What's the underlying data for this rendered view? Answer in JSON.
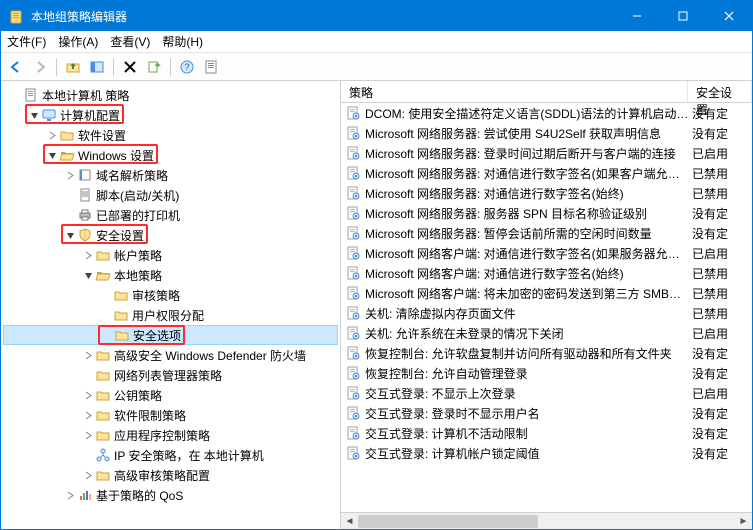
{
  "window": {
    "title": "本地组策略编辑器"
  },
  "menu": {
    "file": "文件(F)",
    "action": "操作(A)",
    "view": "查看(V)",
    "help": "帮助(H)"
  },
  "tree": {
    "root": "本地计算机 策略",
    "computer_cfg": "计算机配置",
    "software": "软件设置",
    "windows_settings": "Windows 设置",
    "dns": "域名解析策略",
    "scripts": "脚本(启动/关机)",
    "deployed_printers": "已部署的打印机",
    "security_settings": "安全设置",
    "account_policies": "帐户策略",
    "local_policies": "本地策略",
    "audit": "审核策略",
    "user_rights": "用户权限分配",
    "security_options": "安全选项",
    "defender": "高级安全 Windows Defender 防火墙",
    "nlm": "网络列表管理器策略",
    "pki": "公钥策略",
    "srp": "软件限制策略",
    "acp": "应用程序控制策略",
    "ipsec": "IP 安全策略，在 本地计算机",
    "aap": "高级审核策略配置",
    "qos": "基于策略的 QoS"
  },
  "list": {
    "header_policy": "策略",
    "header_setting": "安全设置",
    "rows": [
      {
        "name": "DCOM: 使用安全描述符定义语言(SDDL)语法的计算机启动…",
        "setting": "没有定"
      },
      {
        "name": "Microsoft 网络服务器: 尝试使用 S4U2Self 获取声明信息",
        "setting": "没有定"
      },
      {
        "name": "Microsoft 网络服务器: 登录时间过期后断开与客户端的连接",
        "setting": "已启用"
      },
      {
        "name": "Microsoft 网络服务器: 对通信进行数字签名(如果客户端允…",
        "setting": "已禁用"
      },
      {
        "name": "Microsoft 网络服务器: 对通信进行数字签名(始终)",
        "setting": "已禁用"
      },
      {
        "name": "Microsoft 网络服务器: 服务器 SPN 目标名称验证级别",
        "setting": "没有定"
      },
      {
        "name": "Microsoft 网络服务器: 暂停会话前所需的空闲时间数量",
        "setting": "没有定"
      },
      {
        "name": "Microsoft 网络客户端: 对通信进行数字签名(如果服务器允…",
        "setting": "已启用"
      },
      {
        "name": "Microsoft 网络客户端: 对通信进行数字签名(始终)",
        "setting": "已禁用"
      },
      {
        "name": "Microsoft 网络客户端: 将未加密的密码发送到第三方 SMB…",
        "setting": "已禁用"
      },
      {
        "name": "关机: 清除虚拟内存页面文件",
        "setting": "已禁用"
      },
      {
        "name": "关机: 允许系统在未登录的情况下关闭",
        "setting": "已启用"
      },
      {
        "name": "恢复控制台: 允许软盘复制并访问所有驱动器和所有文件夹",
        "setting": "没有定"
      },
      {
        "name": "恢复控制台: 允许自动管理登录",
        "setting": "没有定"
      },
      {
        "name": "交互式登录: 不显示上次登录",
        "setting": "已启用"
      },
      {
        "name": "交互式登录: 登录时不显示用户名",
        "setting": "没有定"
      },
      {
        "name": "交互式登录: 计算机不活动限制",
        "setting": "没有定"
      },
      {
        "name": "交互式登录: 计算机帐户锁定阈值",
        "setting": "没有定"
      }
    ]
  }
}
